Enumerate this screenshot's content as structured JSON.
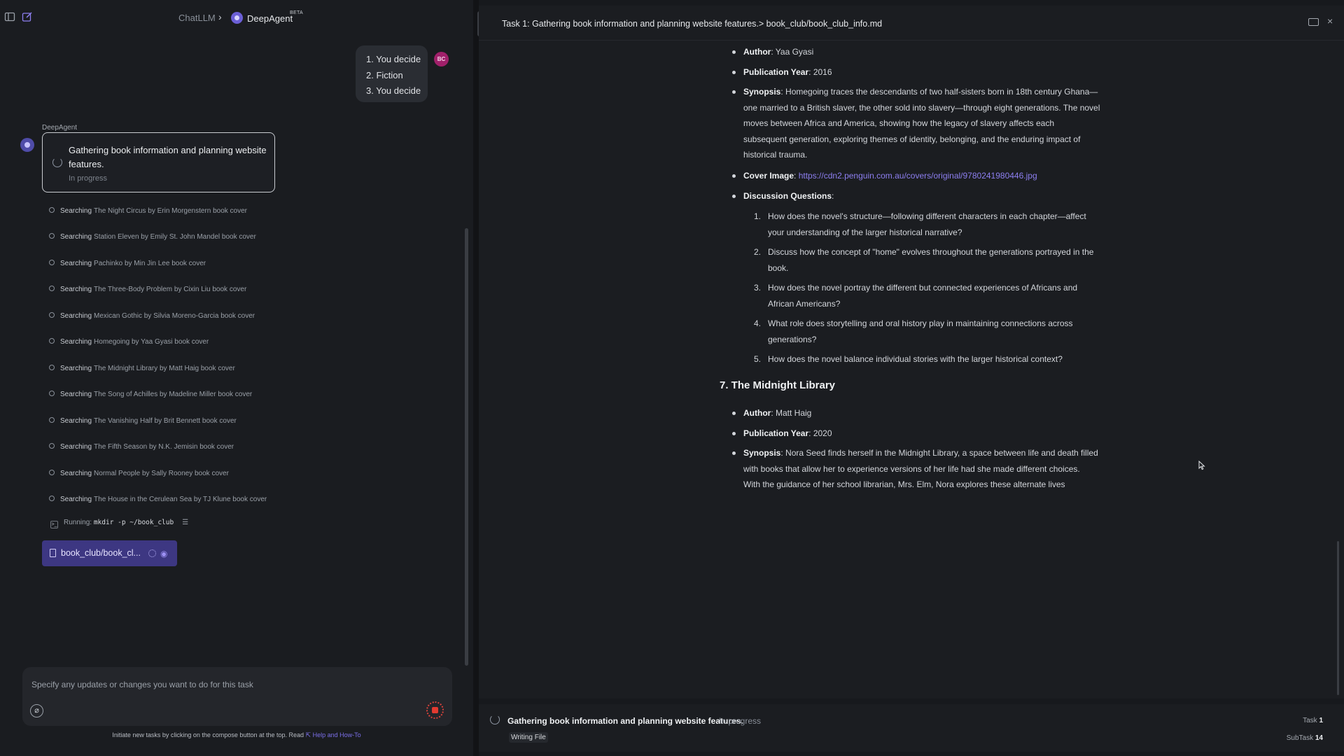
{
  "breadcrumb": {
    "app": "ChatLLM",
    "agent": "DeepAgent",
    "badge": "BETA"
  },
  "user_message": {
    "avatar": "BC",
    "items": [
      "1. You decide",
      "2. Fiction",
      "3. You decide"
    ]
  },
  "agent_label": "DeepAgent",
  "task_card": {
    "title": "Gathering book information and planning website features.",
    "status": "In progress"
  },
  "search_label": "Searching",
  "searches": [
    "The Night Circus by Erin Morgenstern book cover",
    "Station Eleven by Emily St. John Mandel book cover",
    "Pachinko by Min Jin Lee book cover",
    "The Three-Body Problem by Cixin Liu book cover",
    "Mexican Gothic by Silvia Moreno-Garcia book cover",
    "Homegoing by Yaa Gyasi book cover",
    "The Midnight Library by Matt Haig book cover",
    "The Song of Achilles by Madeline Miller book cover",
    "The Vanishing Half by Brit Bennett book cover",
    "The Fifth Season by N.K. Jemisin book cover",
    "Normal People by Sally Rooney book cover",
    "The House in the Cerulean Sea by TJ Klune book cover"
  ],
  "running": {
    "label": "Running:",
    "command": "mkdir -p ~/book_club"
  },
  "file_chip": {
    "name": "book_club/book_cl..."
  },
  "composer": {
    "placeholder": "Specify any updates or changes you want to do for this task"
  },
  "hint": {
    "text": "Initiate new tasks by clicking on the compose button at the top. Read",
    "link": "Help and How-To"
  },
  "right_panel": {
    "title": "Task 1: Gathering book information and planning website features.> book_club/book_club_info.md",
    "doc": {
      "b6_author_label": "Author",
      "b6_author": ": Yaa Gyasi",
      "b6_year_label": "Publication Year",
      "b6_year": ": 2016",
      "b6_syn_label": "Synopsis",
      "b6_syn_1": ": Homegoing traces the descendants of two half-sisters born in 18th century Ghana—",
      "b6_syn_2": "one married to a British slaver, the other sold into slavery—through eight generations. The novel",
      "b6_syn_3": "moves between Africa and America, showing how the legacy of slavery affects each",
      "b6_syn_4": "subsequent generation, exploring themes of identity, belonging, and the enduring impact of",
      "b6_syn_5": "historical trauma.",
      "b6_cover_label": "Cover Image",
      "b6_cover_sep": ": ",
      "b6_cover_url": "https://cdn2.penguin.com.au/covers/original/9780241980446.jpg",
      "b6_dq_label": "Discussion Questions",
      "b6_dq_colon": ":",
      "questions": [
        {
          "n": "1.",
          "l1": "How does the novel's structure—following different characters in each chapter—affect",
          "l2": "your understanding of the larger historical narrative?"
        },
        {
          "n": "2.",
          "l1": "Discuss how the concept of \"home\" evolves throughout the generations portrayed in the",
          "l2": "book."
        },
        {
          "n": "3.",
          "l1": "How does the novel portray the different but connected experiences of Africans and",
          "l2": "African Americans?"
        },
        {
          "n": "4.",
          "l1": "What role does storytelling and oral history play in maintaining connections across",
          "l2": "generations?"
        },
        {
          "n": "5.",
          "l1": "How does the novel balance individual stories with the larger historical context?",
          "l2": ""
        }
      ],
      "b7_heading": "7. The Midnight Library",
      "b7_author_label": "Author",
      "b7_author": ": Matt Haig",
      "b7_year_label": "Publication Year",
      "b7_year": ": 2020",
      "b7_syn_label": "Synopsis",
      "b7_syn_1": ": Nora Seed finds herself in the Midnight Library, a space between life and death filled",
      "b7_syn_2": "with books that allow her to experience versions of her life had she made different choices.",
      "b7_syn_3": "With the guidance of her school librarian, Mrs. Elm, Nora explores these alternate lives"
    }
  },
  "bottom_bar": {
    "title": "Gathering book information and planning website features.",
    "status": "In progress",
    "action": "Writing File",
    "task_label": "Task",
    "task_num": "1",
    "subtask_label": "SubTask",
    "subtask_num": "14"
  }
}
